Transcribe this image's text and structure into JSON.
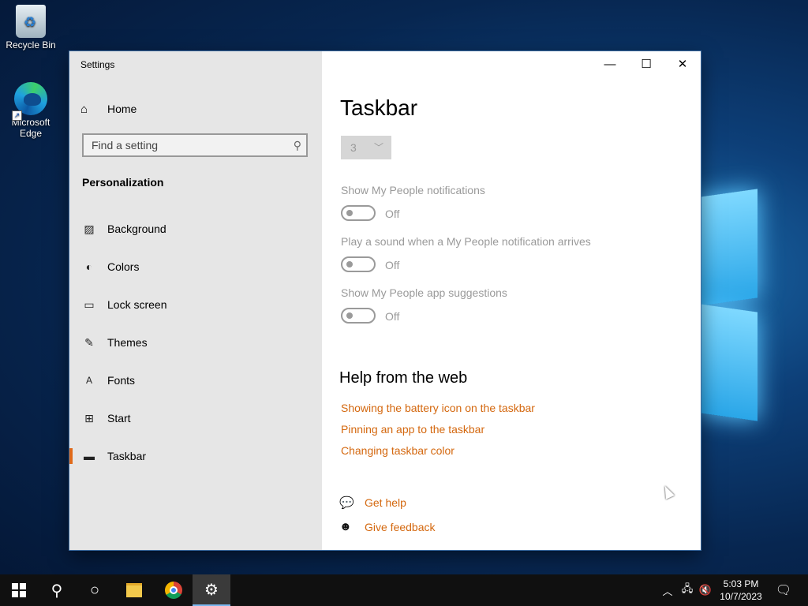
{
  "desktop": {
    "icons": [
      {
        "label": "Recycle Bin"
      },
      {
        "label": "Microsoft Edge"
      }
    ]
  },
  "window": {
    "title": "Settings",
    "controls": {
      "minimize": "—",
      "maximize": "☐",
      "close": "✕"
    }
  },
  "sidebar": {
    "home_label": "Home",
    "search_placeholder": "Find a setting",
    "section_title": "Personalization",
    "items": [
      {
        "label": "Background",
        "icon": "image-icon"
      },
      {
        "label": "Colors",
        "icon": "palette-icon"
      },
      {
        "label": "Lock screen",
        "icon": "monitor-icon"
      },
      {
        "label": "Themes",
        "icon": "brush-icon"
      },
      {
        "label": "Fonts",
        "icon": "font-icon"
      },
      {
        "label": "Start",
        "icon": "start-icon"
      },
      {
        "label": "Taskbar",
        "icon": "taskbar-icon",
        "active": true
      }
    ]
  },
  "main": {
    "title": "Taskbar",
    "dropdown_value": "3",
    "settings": [
      {
        "label": "Show My People notifications",
        "state": "Off"
      },
      {
        "label": "Play a sound when a My People notification arrives",
        "state": "Off"
      },
      {
        "label": "Show My People app suggestions",
        "state": "Off"
      }
    ],
    "help": {
      "title": "Help from the web",
      "links": [
        "Showing the battery icon on the taskbar",
        "Pinning an app to the taskbar",
        "Changing taskbar color"
      ]
    },
    "actions": {
      "get_help": "Get help",
      "give_feedback": "Give feedback"
    }
  },
  "taskbar": {
    "time": "5:03 PM",
    "date": "10/7/2023"
  },
  "colors": {
    "accent": "#d4680f",
    "active_indicator": "#e06a1a"
  }
}
